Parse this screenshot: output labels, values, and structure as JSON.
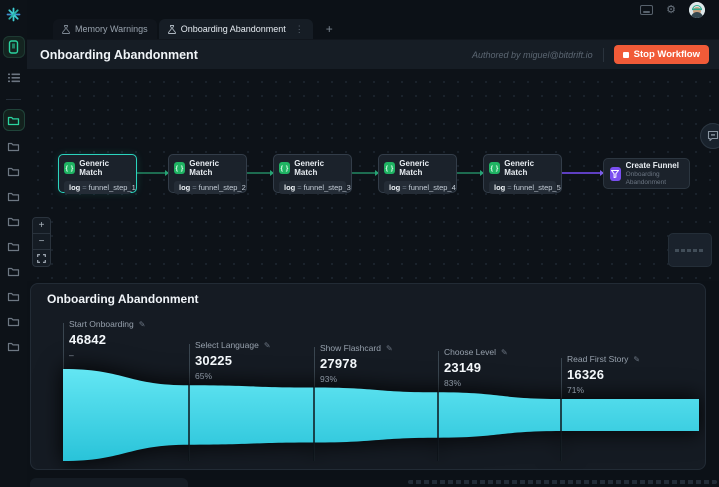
{
  "brand": {
    "name": "bitdrift",
    "accent_teal": "#2bd4be",
    "funnel_cyan": "#3ed3e8",
    "node_green": "#1fb363",
    "funnel_purple": "#7a4ff0",
    "stop_red": "#f15b38"
  },
  "tabs": {
    "items": [
      {
        "label": "Memory Warnings",
        "active": false
      },
      {
        "label": "Onboarding Abandonment",
        "active": true
      }
    ],
    "add_label": "+",
    "kebab": "⋮"
  },
  "header": {
    "title": "Onboarding Abandonment",
    "authored_by": "Authored by miguel@bitdrift.io",
    "stop_label": "Stop Workflow"
  },
  "workflow": {
    "nodes": [
      {
        "title": "Generic Match",
        "icon": "{ }",
        "field": "log",
        "op": "=",
        "value": "funnel_step_1"
      },
      {
        "title": "Generic Match",
        "icon": "{ }",
        "field": "log",
        "op": "=",
        "value": "funnel_step_2"
      },
      {
        "title": "Generic Match",
        "icon": "{ }",
        "field": "log",
        "op": "=",
        "value": "funnel_step_3"
      },
      {
        "title": "Generic Match",
        "icon": "{ }",
        "field": "log",
        "op": "=",
        "value": "funnel_step_4"
      },
      {
        "title": "Generic Match",
        "icon": "{ }",
        "field": "log",
        "op": "=",
        "value": "funnel_step_5"
      }
    ],
    "output_node": {
      "title": "Create Funnel",
      "subtitle": "Onboarding Abandonment"
    },
    "controls": {
      "zoom_in": "+",
      "zoom_out": "−"
    }
  },
  "funnel_panel": {
    "title": "Onboarding Abandonment",
    "steps": [
      {
        "label": "Start Onboarding",
        "value": "46842",
        "pct": "–"
      },
      {
        "label": "Select Language",
        "value": "30225",
        "pct": "65%"
      },
      {
        "label": "Show Flashcard",
        "value": "27978",
        "pct": "93%"
      },
      {
        "label": "Choose Level",
        "value": "23149",
        "pct": "83%"
      },
      {
        "label": "Read First Story",
        "value": "16326",
        "pct": "71%"
      }
    ]
  },
  "chart_data": {
    "type": "funnel",
    "title": "Onboarding Abandonment",
    "orientation": "horizontal",
    "categories": [
      "Start Onboarding",
      "Select Language",
      "Show Flashcard",
      "Choose Level",
      "Read First Story"
    ],
    "values": [
      46842,
      30225,
      27978,
      23149,
      16326
    ],
    "conversion_from_previous": [
      null,
      0.65,
      0.93,
      0.83,
      0.71
    ],
    "color": "#3ed3e8",
    "legend": false,
    "grid": false
  }
}
